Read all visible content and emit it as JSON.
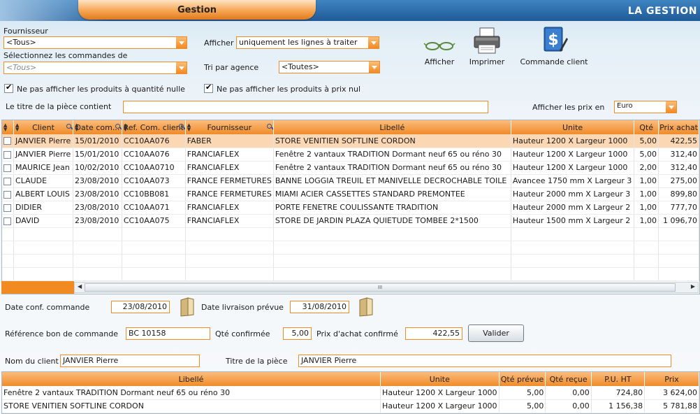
{
  "header": {
    "tab_label": "Gestion",
    "app_title": "LA GESTION"
  },
  "filters": {
    "fournisseur_label": "Fournisseur",
    "fournisseur_value": "<Tous>",
    "commandes_label": "Sélectionnez les commandes de",
    "commandes_value": "<Tous>",
    "afficher_label": "Afficher",
    "afficher_value": "uniquement les lignes à traiter",
    "tri_label": "Tri par agence",
    "tri_value": "<Toutes>",
    "chk_quantite_label": "Ne pas afficher les produits à quantité nulle",
    "chk_prix_label": "Ne pas afficher les produits à prix nul",
    "titre_label": "Le titre de la pièce contient",
    "titre_value": "",
    "prix_en_label": "Afficher les prix en",
    "prix_en_value": "Euro"
  },
  "toolbar": {
    "afficher_label": "Afficher",
    "imprimer_label": "Imprimer",
    "commande_client_label": "Commande client"
  },
  "grid": {
    "columns": [
      "Client",
      "Date com...",
      "Ref. Com. client",
      "Fournisseur",
      "Libellé",
      "Unite",
      "Qté",
      "Prix achat"
    ],
    "rows": [
      [
        "JANVIER Pierre",
        "15/01/2010",
        "CC10AA076",
        "FABER",
        "STORE VENITIEN SOFTLINE CORDON",
        "Hauteur 1200 X Largeur 1000",
        "5,00",
        "422,55"
      ],
      [
        "JANVIER Pierre",
        "15/01/2010",
        "CC10AA076",
        "FRANCIAFLEX",
        "Fenêtre 2 vantaux TRADITION Dormant neuf 65 ou réno 30",
        "Hauteur 1200 X Largeur 1000",
        "5,00",
        "312,40"
      ],
      [
        "MAURICE Jean",
        "10/02/2010",
        "CC10AA0710",
        "FRANCIAFLEX",
        "Fenêtre 2 vantaux TRADITION Dormant neuf 65 ou réno 30",
        "Hauteur 1200 X Largeur 1000",
        "2,00",
        "312,40"
      ],
      [
        "CLAUDE",
        "23/08/2010",
        "CC10AA073",
        "FRANCE FERMETURES",
        "BANNE LOGGIA TREUIL ET MANIVELLE DECROCHABLE TOILE",
        "Avancee 1750 mm X Largeur 3",
        "1,00",
        "275,00"
      ],
      [
        "ALBERT LOUIS",
        "23/08/2010",
        "CC10BB081",
        "FRANCE FERMETURES",
        "MIAMI ACIER CASSETTES STANDARD PREMONTEE",
        "Hauteur 2000 mm X Largeur 3",
        "1,00",
        "899,80"
      ],
      [
        "DIDIER",
        "23/08/2010",
        "CC10AA071",
        "FRANCIAFLEX",
        "PORTE FENETRE COULISSANTE TRADITION",
        "Hauteur 2000 mm X Largeur 2",
        "1,00",
        "777,70"
      ],
      [
        "DAVID",
        "23/08/2010",
        "CC10AA075",
        "FRANCIAFLEX",
        "STORE DE JARDIN PLAZA QUIETUDE TOMBEE 2*1500",
        "Hauteur 1500 mm X Largeur 2",
        "1,00",
        "1 096,70"
      ]
    ],
    "scroll_grip": "III"
  },
  "details": {
    "date_conf_label": "Date conf. commande",
    "date_conf_value": "23/08/2010",
    "date_liv_label": "Date livraison prévue",
    "date_liv_value": "31/08/2010",
    "ref_bon_label": "Référence bon de commande",
    "ref_bon_value": "BC 10158",
    "qte_conf_label": "Qté confirmée",
    "qte_conf_value": "5,00",
    "prix_conf_label": "Prix d'achat confirmé",
    "prix_conf_value": "422,55",
    "valider_label": "Valider",
    "nom_client_label": "Nom du client",
    "nom_client_value": "JANVIER Pierre",
    "titre_piece_label": "Titre de la pièce",
    "titre_piece_value": "JANVIER Pierre"
  },
  "grid2": {
    "columns": [
      "Libellé",
      "Unite",
      "Qté prévue",
      "Qté reçue",
      "P.U. HT",
      "Prix"
    ],
    "rows": [
      [
        "Fenêtre 2 vantaux TRADITION Dormant neuf 65 ou réno 30",
        "Hauteur 1200 X Largeur 1000",
        "5,00",
        "0,00",
        "724,80",
        "3 624,00"
      ],
      [
        "STORE VENITIEN SOFTLINE CORDON",
        "Hauteur 1200 X Largeur 1000",
        "5,00",
        "0,00",
        "1 156,38",
        "5 781,88"
      ]
    ]
  },
  "colors": {
    "accent_orange": "#f08b29",
    "selected_row": "#fbd7b4",
    "header_blue": "#1e5a97"
  }
}
